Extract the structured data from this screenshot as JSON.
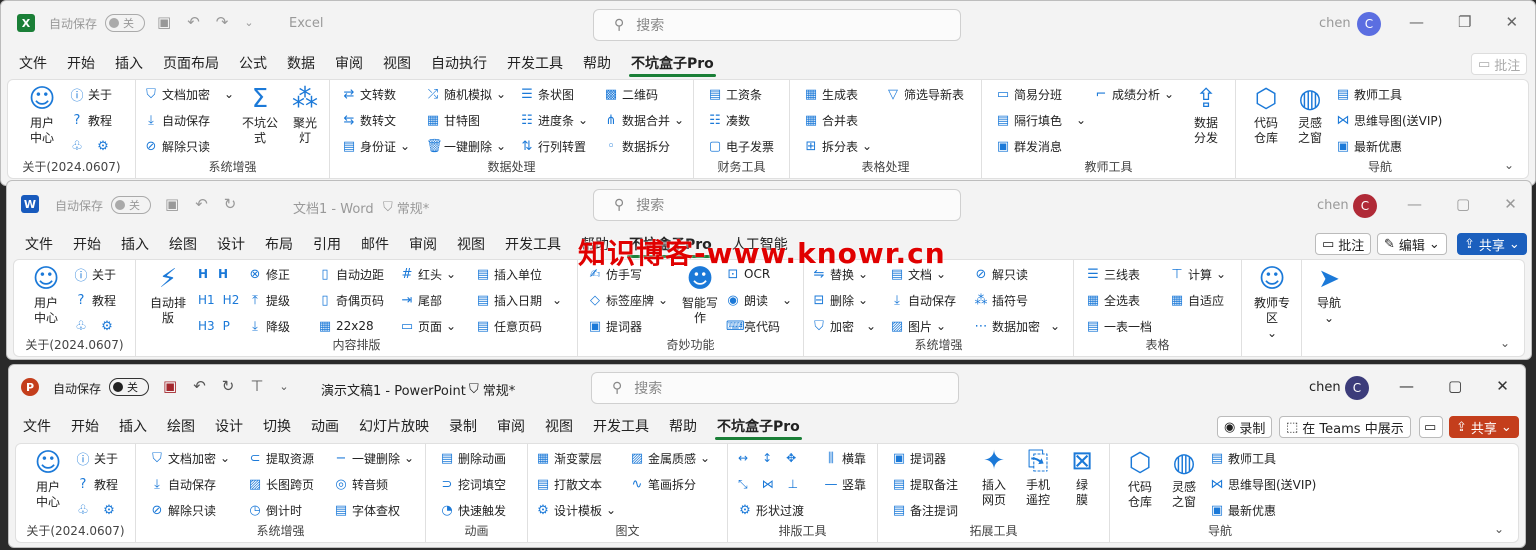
{
  "watermark": "知识博客-www.knowr.cn",
  "excel": {
    "logo": "X",
    "autosave": "自动保存",
    "toggle": "关",
    "app": "Excel",
    "search": "搜索",
    "user": "chen",
    "avatar": "C",
    "tabs": [
      "文件",
      "开始",
      "插入",
      "页面布局",
      "公式",
      "数据",
      "审阅",
      "视图",
      "自动执行",
      "开发工具",
      "帮助",
      "不坑盒子Pro"
    ],
    "comment": "批注",
    "g1": {
      "user_center": "用户\n中心",
      "about": "关于",
      "tutorial": "教程",
      "label": "关于(2024.0607)"
    },
    "g2": {
      "doc_encrypt": "文档加密",
      "autosave": "自动保存",
      "unlock": "解除只读",
      "formula": "不坑公\n式",
      "spotlight": "聚光\n灯",
      "label": "系统增强"
    },
    "g3": {
      "i1": "文转数",
      "i2": "数转文",
      "i3": "身份证",
      "i4": "随机模拟",
      "i5": "甘特图",
      "i6": "一键删除",
      "i7": "条状图",
      "i8": "进度条",
      "i9": "行列转置",
      "i10": "二维码",
      "i11": "数据合并",
      "i12": "数据拆分",
      "label": "数据处理"
    },
    "g4": {
      "i1": "工资条",
      "i2": "凑数",
      "i3": "电子发票",
      "label": "财务工具"
    },
    "g5": {
      "i1": "生成表",
      "i2": "合并表",
      "i3": "拆分表",
      "i4": "筛选导新表",
      "label": "表格处理"
    },
    "g6": {
      "i1": "简易分班",
      "i2": "隔行填色",
      "i3": "群发消息",
      "i4": "成绩分析",
      "i5": "数据\n分发",
      "label": "教师工具"
    },
    "g7": {
      "i1": "代码\n仓库",
      "i2": "灵感\n之窗",
      "i3": "教师工具",
      "i4": "思维导图(送VIP)",
      "i5": "最新优惠",
      "label": "导航"
    }
  },
  "word": {
    "logo": "W",
    "autosave": "自动保存",
    "toggle": "关",
    "doc": "文档1 - Word",
    "sensitivity": "常规*",
    "search": "搜索",
    "user": "chen",
    "avatar": "C",
    "tabs": [
      "文件",
      "开始",
      "插入",
      "绘图",
      "设计",
      "布局",
      "引用",
      "邮件",
      "审阅",
      "视图",
      "开发工具",
      "帮助",
      "不坑盒子Pro",
      "人工智能"
    ],
    "comment": "批注",
    "edit": "编辑",
    "share": "共享",
    "g1": {
      "user_center": "用户\n中心",
      "about": "关于",
      "tutorial": "教程",
      "label": "关于(2024.0607)"
    },
    "g2": {
      "auto_layout": "自动排\n版",
      "fix": "修正",
      "upgrade": "提级",
      "downgrade": "降级",
      "i1": "自动边距",
      "i2": "奇偶页码",
      "i3": "22x28",
      "i4": "红头",
      "i5": "尾部",
      "i6": "页面",
      "i7": "插入单位",
      "i8": "插入日期",
      "i9": "任意页码",
      "label": "内容排版"
    },
    "g3": {
      "i1": "仿手写",
      "i2": "标签座牌",
      "i3": "提词器",
      "i4": "智能写\n作",
      "i5": "OCR",
      "i6": "朗读",
      "i7": "亮代码",
      "label": "奇妙功能"
    },
    "g4": {
      "i1": "替换",
      "i2": "删除",
      "i3": "加密",
      "i4": "文档",
      "i5": "自动保存",
      "i6": "图片",
      "i7": "解只读",
      "i8": "插符号",
      "i9": "数据加密",
      "label": "系统增强"
    },
    "g5": {
      "i1": "三线表",
      "i2": "全选表",
      "i3": "一表一档",
      "i4": "计算",
      "i5": "自适应",
      "label": "表格"
    },
    "g6": {
      "i1": "教师专\n区"
    },
    "g7": {
      "i1": "导航"
    }
  },
  "ppt": {
    "logo": "P",
    "autosave": "自动保存",
    "toggle": "关",
    "doc": "演示文稿1 - PowerPoint",
    "sensitivity": "常规*",
    "search": "搜索",
    "user": "chen",
    "avatar": "C",
    "tabs": [
      "文件",
      "开始",
      "插入",
      "绘图",
      "设计",
      "切换",
      "动画",
      "幻灯片放映",
      "录制",
      "审阅",
      "视图",
      "开发工具",
      "帮助",
      "不坑盒子Pro"
    ],
    "record": "录制",
    "teams": "在 Teams 中展示",
    "share": "共享",
    "g1": {
      "user_center": "用户\n中心",
      "about": "关于",
      "tutorial": "教程",
      "label": "关于(2024.0607)"
    },
    "g2": {
      "i1": "文档加密",
      "i2": "自动保存",
      "i3": "解除只读",
      "i4": "提取资源",
      "i5": "长图跨页",
      "i6": "倒计时",
      "i7": "一键删除",
      "i8": "转音频",
      "i9": "字体查权",
      "label": "系统增强"
    },
    "g3": {
      "i1": "删除动画",
      "i2": "挖词填空",
      "i3": "快速触发",
      "label": "动画"
    },
    "g4": {
      "i1": "渐变蒙层",
      "i2": "打散文本",
      "i3": "设计模板",
      "i4": "金属质感",
      "i5": "笔画拆分",
      "label": "图文"
    },
    "g5": {
      "i1": "横靠",
      "i2": "竖靠",
      "i3": "形状过渡",
      "label": "排版工具"
    },
    "g6": {
      "i1": "提词器",
      "i2": "提取备注",
      "i3": "备注提词",
      "i4": "插入\n网页",
      "i5": "手机\n遥控",
      "i6": "绿\n膜",
      "label": "拓展工具"
    },
    "g7": {
      "i1": "代码\n仓库",
      "i2": "灵感\n之窗",
      "i3": "教师工具",
      "i4": "思维导图(送VIP)",
      "i5": "最新优惠",
      "label": "导航"
    }
  },
  "colors": {
    "excel": "#1a7f37",
    "word": "#185abd",
    "ppt": "#c43e1c",
    "accent": "#1b79d8"
  }
}
